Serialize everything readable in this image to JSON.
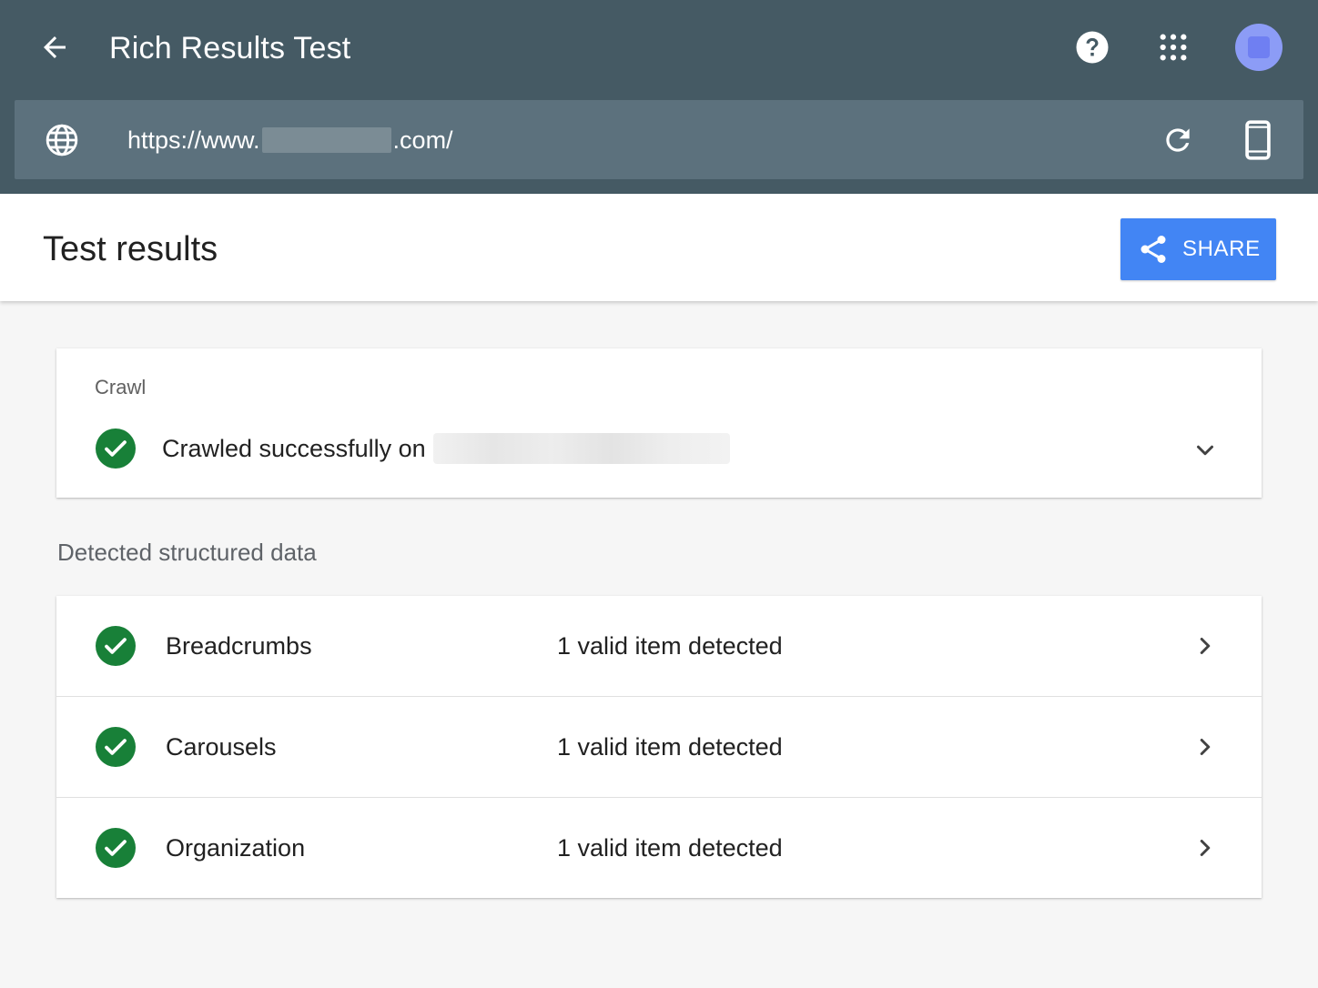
{
  "app": {
    "title": "Rich Results Test"
  },
  "url_bar": {
    "url_prefix": "https://www.",
    "url_suffix": ".com/"
  },
  "results": {
    "title": "Test results",
    "share_label": "SHARE"
  },
  "crawl": {
    "label": "Crawl",
    "status_text": "Crawled successfully on"
  },
  "structured_data": {
    "section_label": "Detected structured data",
    "items": [
      {
        "name": "Breadcrumbs",
        "count_text": "1 valid item detected"
      },
      {
        "name": "Carousels",
        "count_text": "1 valid item detected"
      },
      {
        "name": "Organization",
        "count_text": "1 valid item detected"
      }
    ]
  },
  "colors": {
    "app_bar": "#455a64",
    "url_bar": "#5c717d",
    "accent": "#4285f4",
    "success": "#188038",
    "avatar": "#8c9cf6"
  },
  "icons": {
    "back": "arrow-back-icon",
    "help": "help-icon",
    "apps": "apps-grid-icon",
    "globe": "globe-icon",
    "reload": "reload-icon",
    "device": "smartphone-icon",
    "share": "share-icon",
    "status": "check-circle-icon",
    "expand": "chevron-down-icon",
    "row_open": "chevron-right-icon"
  }
}
